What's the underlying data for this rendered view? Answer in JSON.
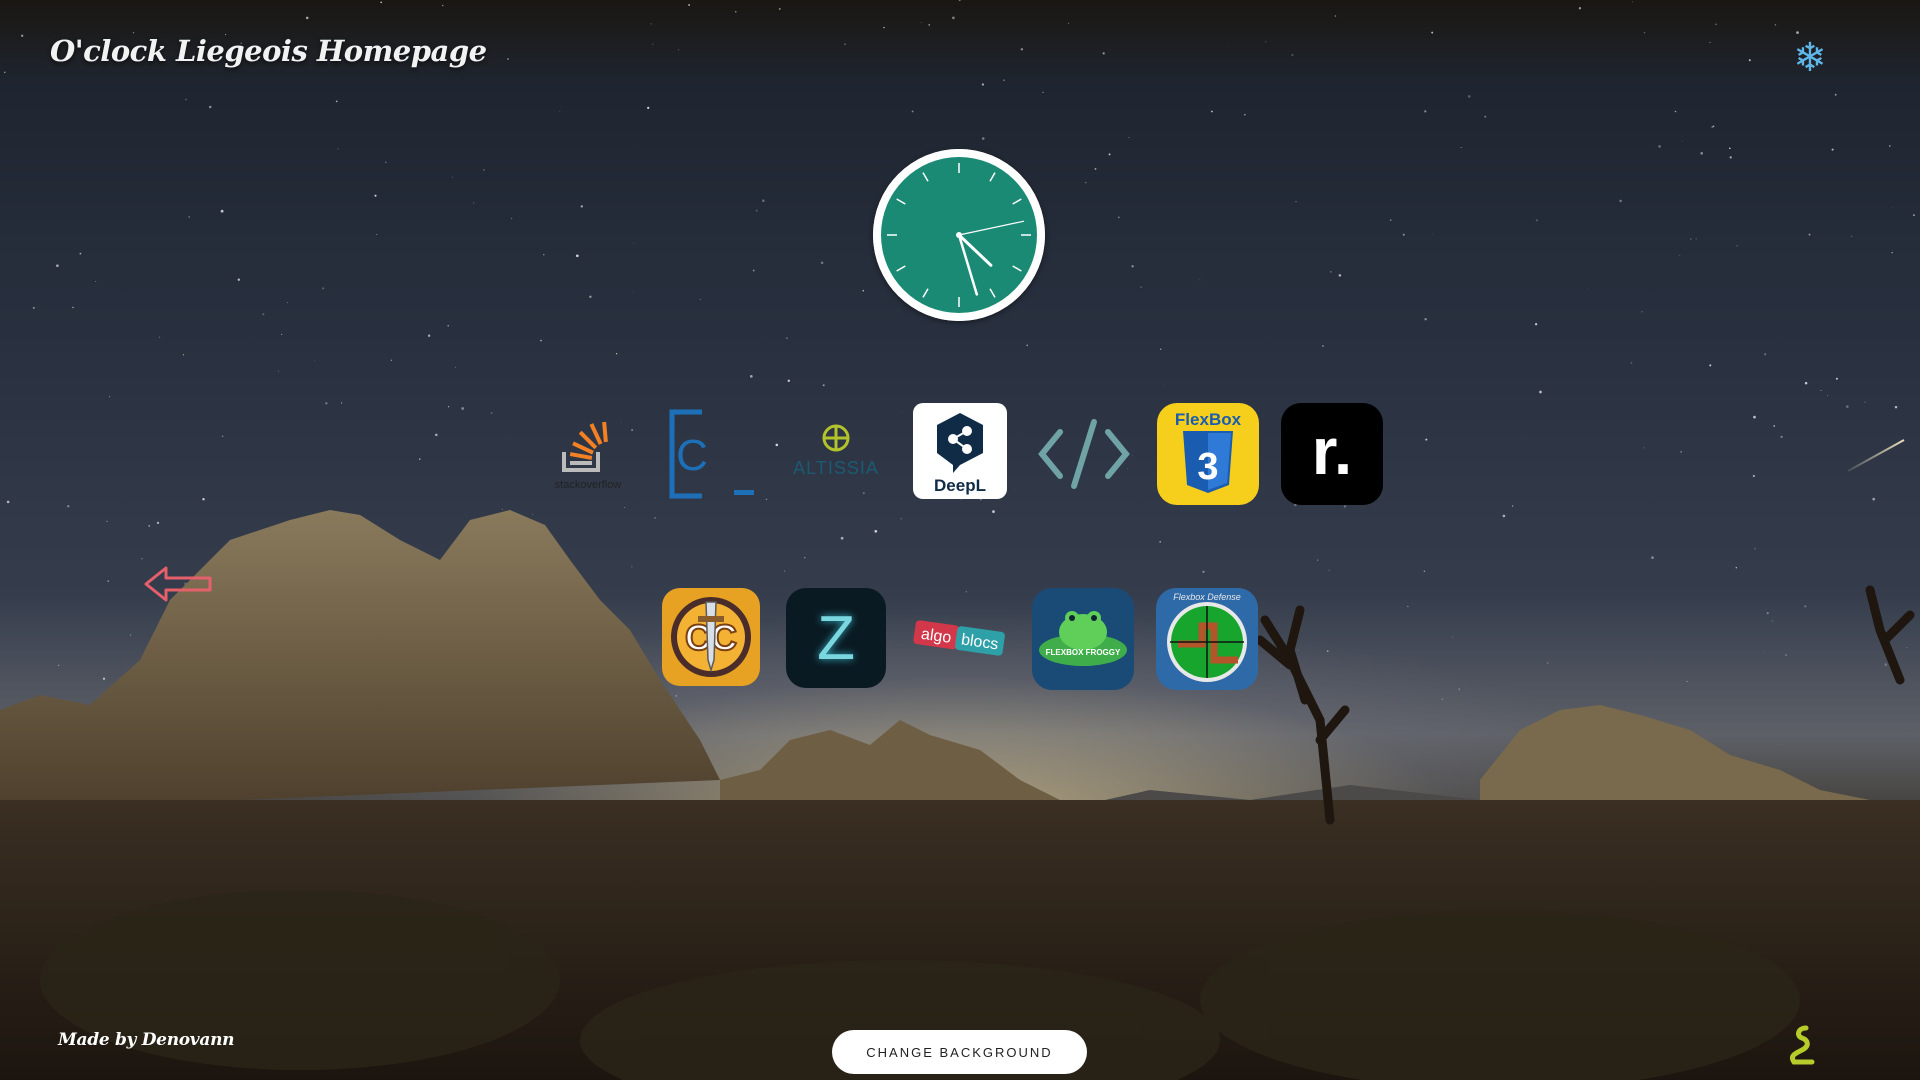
{
  "header": {
    "title": "O'clock Liegeois Homepage",
    "snow_toggle_icon": "snowflake-icon"
  },
  "clock": {
    "hour": 4,
    "minute": 27,
    "second": 13,
    "face_color": "#1b8a75",
    "rim_color": "#ffffff"
  },
  "links_row1": [
    {
      "name": "stackoverflow",
      "label": "stackoverflow",
      "bold_part": "overflow"
    },
    {
      "name": "cours",
      "label": "C"
    },
    {
      "name": "altissia",
      "label": "ALTISSIA"
    },
    {
      "name": "deepl",
      "label": "DeepL"
    },
    {
      "name": "code",
      "label": "</>"
    },
    {
      "name": "flexbox-css",
      "label": "FlexBox"
    },
    {
      "name": "replit",
      "label": "r."
    }
  ],
  "links_row2": [
    {
      "name": "codecombat",
      "label": "CC"
    },
    {
      "name": "zone",
      "label": "Z"
    },
    {
      "name": "algobloc",
      "label_a": "algo",
      "label_b": "blocs"
    },
    {
      "name": "flexbox-froggy",
      "label": "FLEXBOX FROGGY"
    },
    {
      "name": "flexbox-defense",
      "label": "Flexbox Defense"
    }
  ],
  "footer": {
    "made_by": "Made by Denovann",
    "change_background": "CHANGE BACKGROUND",
    "corner_icon": "snake-icon"
  },
  "colors": {
    "accent": "#1b8a75",
    "arrow": "#e5606b",
    "snow": "#5fb6e8",
    "snake": "#b5cc2a"
  }
}
